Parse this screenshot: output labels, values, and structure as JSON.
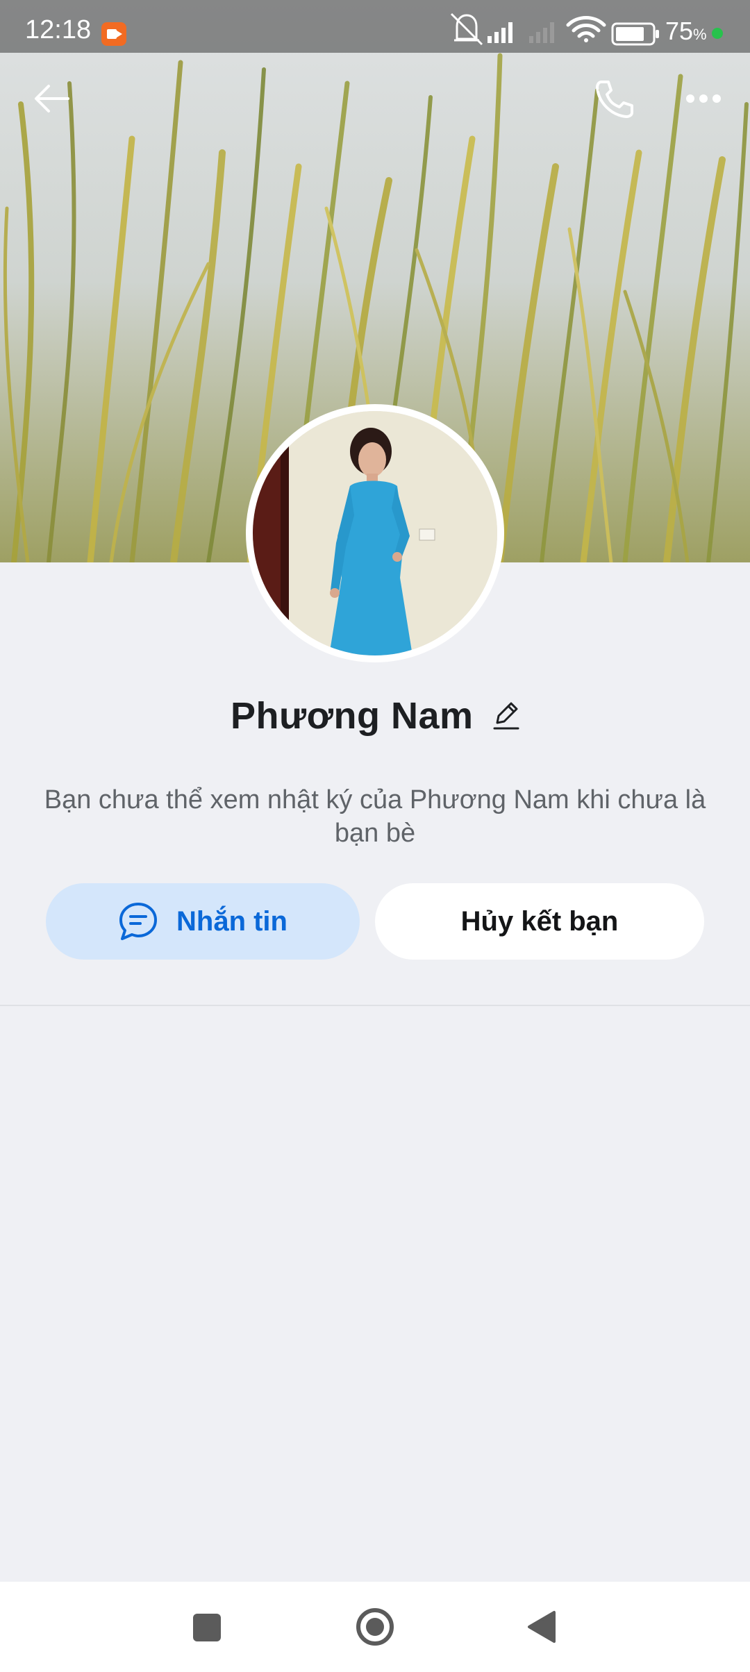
{
  "status_bar": {
    "time": "12:18",
    "battery_percent": "75",
    "battery_unit": "%",
    "icons": [
      "screen-record-icon",
      "mute-bell-icon",
      "signal-icon",
      "signal-weak-icon",
      "wifi-icon",
      "battery-icon"
    ]
  },
  "header": {
    "back_icon": "arrow-left-icon",
    "call_icon": "phone-icon",
    "more_icon": "more-dots-icon"
  },
  "profile": {
    "name": "Phương Nam",
    "edit_icon": "pencil-icon",
    "notice": "Bạn chưa thể xem nhật ký của Phương Nam khi chưa là bạn bè"
  },
  "actions": {
    "message_label": "Nhắn tin",
    "message_icon": "chat-bubble-icon",
    "unfriend_label": "Hủy kết bạn"
  },
  "colors": {
    "accent": "#0a68d8",
    "accent_bg": "#d4e6fb",
    "page_bg": "#eff0f4"
  },
  "nav": {
    "icons": [
      "recents-square-icon",
      "home-circle-icon",
      "back-triangle-icon"
    ]
  }
}
